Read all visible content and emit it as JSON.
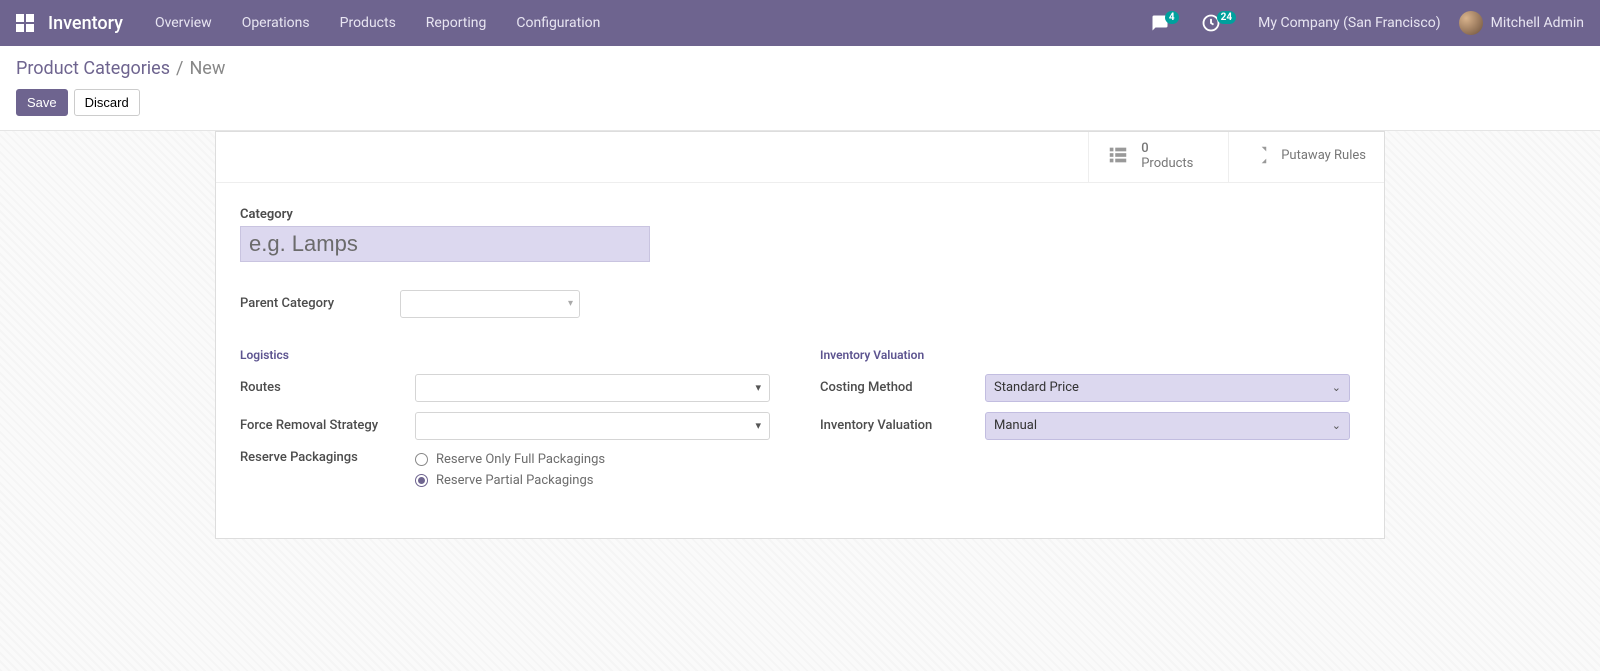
{
  "navbar": {
    "brand": "Inventory",
    "menu": [
      "Overview",
      "Operations",
      "Products",
      "Reporting",
      "Configuration"
    ],
    "messages_badge": "4",
    "activities_badge": "24",
    "company": "My Company (San Francisco)",
    "user": "Mitchell Admin"
  },
  "breadcrumb": {
    "parent": "Product Categories",
    "current": "New"
  },
  "buttons": {
    "save": "Save",
    "discard": "Discard"
  },
  "stat": {
    "products_count": "0",
    "products_label": "Products",
    "putaway_label": "Putaway Rules"
  },
  "form": {
    "category_label": "Category",
    "category_placeholder": "e.g. Lamps",
    "parent_label": "Parent Category",
    "logistics_title": "Logistics",
    "routes_label": "Routes",
    "removal_label": "Force Removal Strategy",
    "reserve_label": "Reserve Packagings",
    "reserve_opt_full": "Reserve Only Full Packagings",
    "reserve_opt_partial": "Reserve Partial Packagings",
    "valuation_title": "Inventory Valuation",
    "costing_label": "Costing Method",
    "costing_value": "Standard Price",
    "invval_label": "Inventory Valuation",
    "invval_value": "Manual"
  }
}
